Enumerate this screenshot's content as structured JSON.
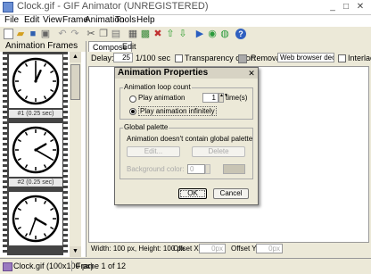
{
  "window": {
    "title": "Clock.gif - GIF Animator (UNREGISTERED)",
    "buttons": [
      "_",
      "□",
      "✕"
    ]
  },
  "menu": [
    "File",
    "Edit",
    "View",
    "Frame",
    "Animation",
    "Tools",
    "Help"
  ],
  "frames_panel": {
    "header": "Animation Frames",
    "frames": [
      {
        "label": "#1 (0.25 sec)",
        "hour_hand_deg": 25,
        "minute_hand_deg": 0
      },
      {
        "label": "#2 (0.25 sec)",
        "hour_hand_deg": 60,
        "minute_hand_deg": 120
      },
      {
        "label": "",
        "hour_hand_deg": 120,
        "minute_hand_deg": 200
      }
    ]
  },
  "tabs": [
    "Compose",
    "Edit"
  ],
  "options": {
    "delay_label": "Delay:",
    "delay_value": "25",
    "delay_unit": "1/100 sec",
    "transparency_label": "Transparency color:",
    "removal_label": "Removal:",
    "removal_value": "Web browser dec",
    "interlaced_label": "Interlac"
  },
  "bottom": {
    "size_text": "Width: 100 px, Height: 100 px",
    "offset_x_label": "Offset X:",
    "offset_x_value": "0px",
    "offset_y_label": "Offset Y:",
    "offset_y_value": "0px"
  },
  "status": {
    "file": "Clock.gif (100x100 px)",
    "frame": "Frame 1 of 12"
  },
  "dialog": {
    "title": "Animation Properties",
    "loop_group": "Animation loop count",
    "play_label": "Play animation",
    "play_times": "1",
    "times_label": "time(s)",
    "infinite_label": "Play animation infinitely",
    "palette_group": "Global palette",
    "palette_text": "Animation doesn't contain global palette",
    "edit_btn": "Edit...",
    "delete_btn": "Delete",
    "bg_label": "Background color:",
    "bg_value": "0",
    "ok_btn": "OK",
    "cancel_btn": "Cancel"
  }
}
